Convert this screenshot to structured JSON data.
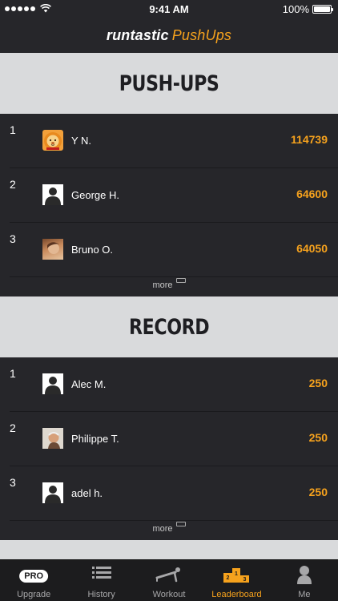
{
  "status_bar": {
    "time": "9:41 AM",
    "battery_percent": "100%",
    "battery_level": 1.0
  },
  "nav": {
    "brand": "runtastic",
    "app": "PushUps"
  },
  "sections": [
    {
      "title": "PUSH-UPS",
      "rows": [
        {
          "rank": "1",
          "name": "Y N.",
          "score": "114739",
          "avatar": "lion-avatar-icon"
        },
        {
          "rank": "2",
          "name": "George H.",
          "score": "64600",
          "avatar": "default-user-avatar-icon"
        },
        {
          "rank": "3",
          "name": "Bruno O.",
          "score": "64050",
          "avatar": "photo-avatar"
        }
      ],
      "more_label": "more"
    },
    {
      "title": "RECORD",
      "rows": [
        {
          "rank": "1",
          "name": "Alec M.",
          "score": "250",
          "avatar": "default-user-avatar-icon"
        },
        {
          "rank": "2",
          "name": "Philippe T.",
          "score": "250",
          "avatar": "photo-avatar"
        },
        {
          "rank": "3",
          "name": "adel h.",
          "score": "250",
          "avatar": "default-user-avatar-icon"
        }
      ],
      "more_label": "more"
    }
  ],
  "tabs": [
    {
      "label": "Upgrade",
      "icon": "pro-badge-icon",
      "active": false,
      "badge": "PRO"
    },
    {
      "label": "History",
      "icon": "list-icon",
      "active": false
    },
    {
      "label": "Workout",
      "icon": "pushup-icon",
      "active": false
    },
    {
      "label": "Leaderboard",
      "icon": "podium-icon",
      "active": true
    },
    {
      "label": "Me",
      "icon": "person-icon",
      "active": false
    }
  ],
  "colors": {
    "accent": "#f6a21d",
    "background": "#26262a",
    "section_header": "#d9dadc"
  }
}
